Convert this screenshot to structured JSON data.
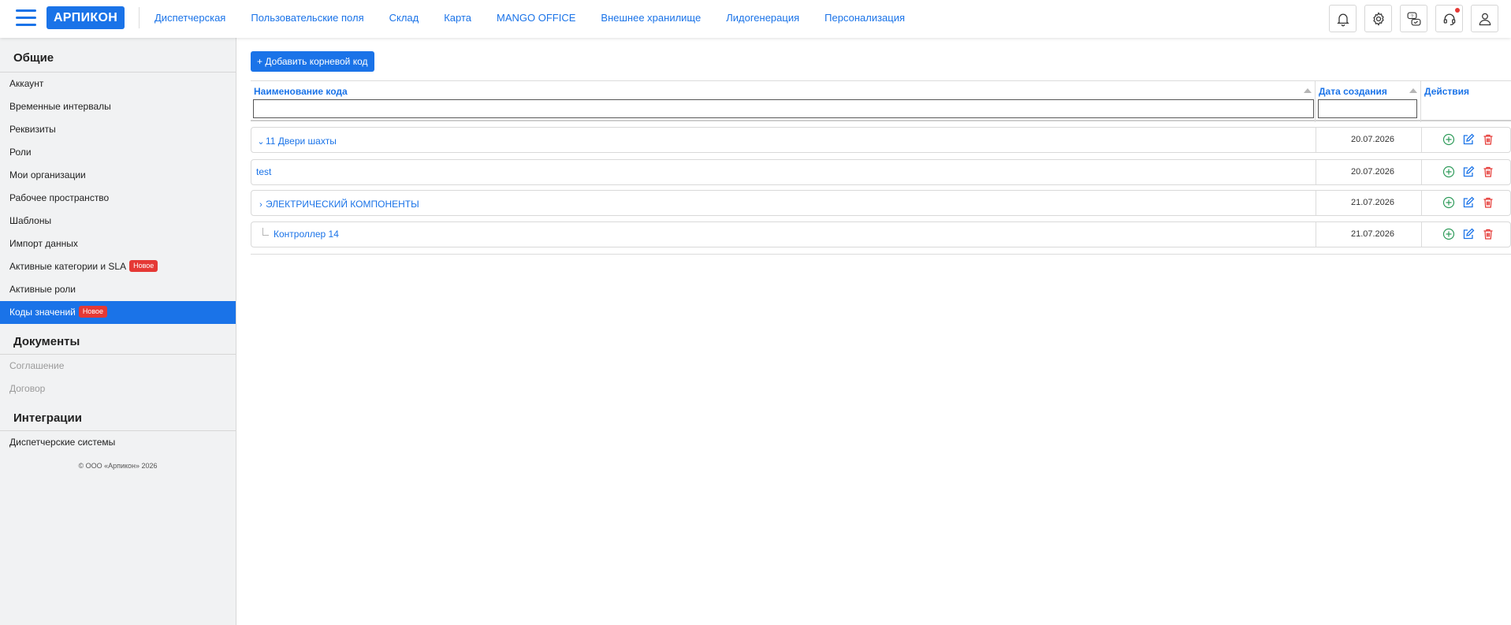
{
  "header": {
    "brand": "АРПИКОН",
    "nav": [
      "Диспетчерская",
      "Пользовательские поля",
      "Склад",
      "Карта",
      "MANGO OFFICE",
      "Внешнее хранилище",
      "Лидогенерация",
      "Персонализация"
    ],
    "icons": [
      "bell-icon",
      "gear-icon",
      "help-chat-icon",
      "support-headset-icon",
      "user-icon"
    ]
  },
  "sidebar": {
    "sections": [
      {
        "title": "Общие",
        "items": [
          {
            "label": "Аккаунт"
          },
          {
            "label": "Временные интервалы"
          },
          {
            "label": "Реквизиты"
          },
          {
            "label": "Роли"
          },
          {
            "label": "Мои организации"
          },
          {
            "label": "Рабочее пространство"
          },
          {
            "label": "Шаблоны"
          },
          {
            "label": "Импорт данных"
          },
          {
            "label": "Активные категории и SLA",
            "badge": "Новое"
          },
          {
            "label": "Активные роли"
          },
          {
            "label": "Коды значений",
            "badge": "Новое",
            "active": true
          }
        ]
      },
      {
        "title": "Документы",
        "items": [
          {
            "label": "Соглашение",
            "disabled": true
          },
          {
            "label": "Договор",
            "disabled": true
          }
        ]
      },
      {
        "title": "Интеграции",
        "items": [
          {
            "label": "Диспетчерские системы"
          }
        ]
      }
    ],
    "copyright": "© ООО «Арпикон» 2026"
  },
  "main": {
    "add_button": "+ Добавить корневой код",
    "columns": {
      "name": "Наименование кода",
      "date": "Дата создания",
      "actions": "Действия"
    },
    "filters": {
      "name": "",
      "date": ""
    },
    "rows": [
      {
        "name": "11 Двери шахты",
        "date": "20.07.2026",
        "toggle": "expanded"
      },
      {
        "name": "test",
        "date": "20.07.2026",
        "toggle": "none"
      },
      {
        "name": "ЭЛЕКТРИЧЕСКИЙ КОМПОНЕНТЫ",
        "date": "21.07.2026",
        "toggle": "collapsed"
      },
      {
        "name": "Контроллер 14",
        "date": "21.07.2026",
        "toggle": "child"
      }
    ]
  },
  "colors": {
    "accent": "#1a73e8",
    "badge": "#e53935",
    "add_action": "#2e9b5a",
    "edit_action": "#1a73e8",
    "delete_action": "#e53935"
  }
}
